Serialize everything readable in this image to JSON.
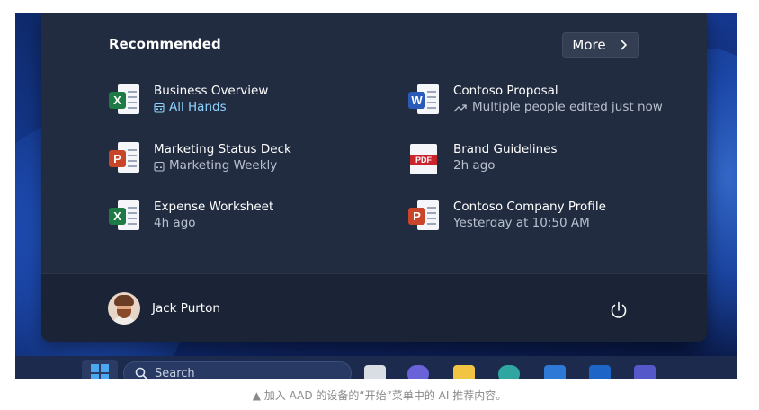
{
  "start_menu": {
    "recommended_title": "Recommended",
    "more_label": "More",
    "items": [
      {
        "name": "Business Overview",
        "sub": "All Hands",
        "icon": "excel-file-icon",
        "sub_icon": "meeting-calendar-icon"
      },
      {
        "name": "Contoso Proposal",
        "sub": "Multiple people edited just now",
        "icon": "word-file-icon",
        "sub_icon": "trending-icon"
      },
      {
        "name": "Marketing Status Deck",
        "sub": "Marketing Weekly",
        "icon": "powerpoint-file-icon",
        "sub_icon": "meeting-calendar-icon"
      },
      {
        "name": "Brand Guidelines",
        "sub": "2h ago",
        "icon": "pdf-file-icon",
        "pdf_label": "PDF"
      },
      {
        "name": "Expense Worksheet",
        "sub": "4h ago",
        "icon": "excel-file-icon"
      },
      {
        "name": "Contoso Company Profile",
        "sub": "Yesterday at 10:50 AM",
        "icon": "powerpoint-file-icon"
      }
    ],
    "user_name": "Jack Purton"
  },
  "taskbar": {
    "search_placeholder": "Search"
  },
  "caption": "▲ 加入 AAD 的设备的“开始”菜单中的 AI 推荐内容。",
  "colors": {
    "menu_bg": "#222c40",
    "accent_link": "#8fd3ff",
    "excel": "#1f7b45",
    "word": "#2a5bb8",
    "powerpoint": "#c8452a",
    "pdf": "#c8252f"
  }
}
